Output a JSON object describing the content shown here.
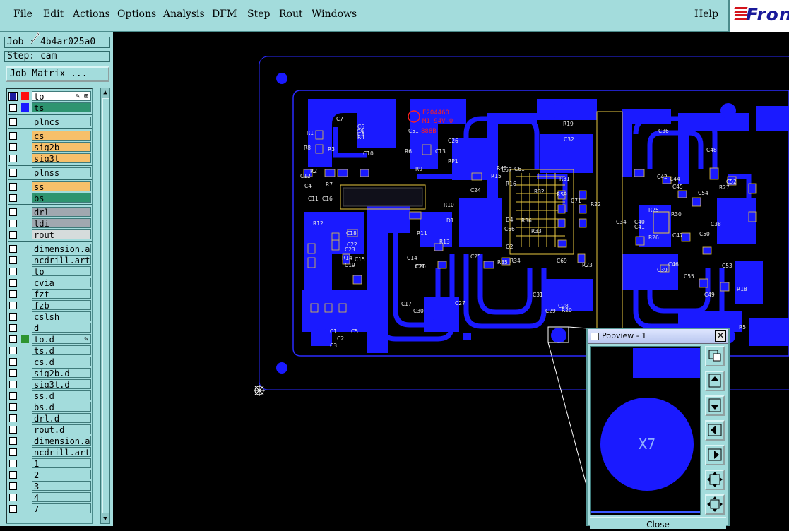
{
  "menu": {
    "items": [
      "File",
      "Edit",
      "Actions",
      "Options",
      "Analysis",
      "DFM",
      "Step",
      "Rout",
      "Windows"
    ],
    "help": "Help"
  },
  "logo": {
    "text": "Fron",
    "name": "frontline-logo"
  },
  "job": {
    "label": "Job : 4b4ar025a0",
    "step": "Step: cam"
  },
  "job_matrix_button": "Job Matrix ...",
  "layers": [
    {
      "name": "to",
      "color": "#ffffff",
      "swatch": "#ff1010",
      "checked": true,
      "flag": "✎ ⊞"
    },
    {
      "name": "ts",
      "color": "#2e9470",
      "swatch": "#1a1aff",
      "checked": false
    },
    {
      "name": "plncs",
      "color": "#a3dcdc",
      "checked": false
    },
    {
      "name": "cs",
      "color": "#f7c06a",
      "checked": false
    },
    {
      "name": "sig2b",
      "color": "#f7c06a",
      "checked": false
    },
    {
      "name": "sig3t",
      "color": "#f7c06a",
      "checked": false
    },
    {
      "name": "plnss",
      "color": "#a3dcdc",
      "checked": false
    },
    {
      "name": "ss",
      "color": "#f7c06a",
      "checked": false
    },
    {
      "name": "bs",
      "color": "#2e9470",
      "checked": false
    },
    {
      "name": "drl",
      "color": "#a0a8b0",
      "checked": false
    },
    {
      "name": "ldi",
      "color": "#a0a8b0",
      "checked": false
    },
    {
      "name": "rout",
      "color": "#d6dcdc",
      "checked": false
    },
    {
      "name": "dimension.ar",
      "color": "#a3dcdc",
      "checked": false
    },
    {
      "name": "ncdrill.art",
      "color": "#a3dcdc",
      "checked": false
    },
    {
      "name": "tp",
      "color": "#a3dcdc",
      "checked": false
    },
    {
      "name": "cvia",
      "color": "#a3dcdc",
      "checked": false
    },
    {
      "name": "fzt",
      "color": "#a3dcdc",
      "checked": false
    },
    {
      "name": "fzb",
      "color": "#a3dcdc",
      "checked": false
    },
    {
      "name": "cslsh",
      "color": "#a3dcdc",
      "checked": false
    },
    {
      "name": "d",
      "color": "#a3dcdc",
      "checked": false
    },
    {
      "name": "to.d",
      "color": "#a3dcdc",
      "swatch": "#2e9430",
      "checked": false,
      "flag": "✎"
    },
    {
      "name": "ts.d",
      "color": "#a3dcdc",
      "checked": false
    },
    {
      "name": "cs.d",
      "color": "#a3dcdc",
      "checked": false
    },
    {
      "name": "sig2b.d",
      "color": "#a3dcdc",
      "checked": false
    },
    {
      "name": "sig3t.d",
      "color": "#a3dcdc",
      "checked": false
    },
    {
      "name": "ss.d",
      "color": "#a3dcdc",
      "checked": false
    },
    {
      "name": "bs.d",
      "color": "#a3dcdc",
      "checked": false
    },
    {
      "name": "drl.d",
      "color": "#a3dcdc",
      "checked": false
    },
    {
      "name": "rout.d",
      "color": "#a3dcdc",
      "checked": false
    },
    {
      "name": "dimension.ar",
      "color": "#a3dcdc",
      "checked": false
    },
    {
      "name": "ncdrill.art",
      "color": "#a3dcdc",
      "checked": false
    },
    {
      "name": "1",
      "color": "#a3dcdc",
      "checked": false
    },
    {
      "name": "2",
      "color": "#a3dcdc",
      "checked": false
    },
    {
      "name": "3",
      "color": "#a3dcdc",
      "checked": false
    },
    {
      "name": "4",
      "color": "#a3dcdc",
      "checked": false
    },
    {
      "name": "7",
      "color": "#a3dcdc",
      "checked": false
    }
  ],
  "board": {
    "marking_lines": [
      "E204460",
      "M1 94V-0",
      "888B"
    ],
    "refdes": [
      {
        "t": "C51"
      },
      {
        "t": "C26"
      },
      {
        "t": "R19"
      },
      {
        "t": "C36"
      },
      {
        "t": "C48"
      },
      {
        "t": "C32"
      },
      {
        "t": "C24"
      },
      {
        "t": "R10"
      },
      {
        "t": "D1"
      },
      {
        "t": "R11"
      },
      {
        "t": "R13"
      },
      {
        "t": "C14"
      },
      {
        "t": "C21"
      },
      {
        "t": "C25"
      },
      {
        "t": "C17"
      },
      {
        "t": "C30"
      },
      {
        "t": "C27"
      },
      {
        "t": "C31"
      },
      {
        "t": "C29"
      },
      {
        "t": "R20"
      },
      {
        "t": "C28"
      },
      {
        "t": "C38"
      },
      {
        "t": "R25"
      },
      {
        "t": "R30"
      },
      {
        "t": "R26"
      },
      {
        "t": "C39"
      },
      {
        "t": "C47"
      },
      {
        "t": "C50"
      },
      {
        "t": "C53"
      },
      {
        "t": "C49"
      },
      {
        "t": "R18"
      },
      {
        "t": "R5"
      },
      {
        "t": "C42"
      },
      {
        "t": "C44"
      },
      {
        "t": "C54"
      },
      {
        "t": "R27"
      },
      {
        "t": "C52"
      },
      {
        "t": "C45"
      },
      {
        "t": "C46"
      },
      {
        "t": "C55"
      },
      {
        "t": "C40"
      },
      {
        "t": "C41"
      },
      {
        "t": "C34"
      },
      {
        "t": "R8"
      },
      {
        "t": "R1"
      },
      {
        "t": "R3"
      },
      {
        "t": "R6"
      },
      {
        "t": "C12"
      },
      {
        "t": "R7"
      },
      {
        "t": "C10"
      },
      {
        "t": "C11"
      },
      {
        "t": "C16"
      },
      {
        "t": "C18"
      },
      {
        "t": "C22"
      },
      {
        "t": "C23"
      },
      {
        "t": "R14"
      },
      {
        "t": "C19"
      },
      {
        "t": "C15"
      },
      {
        "t": "R12"
      },
      {
        "t": "C1"
      },
      {
        "t": "C2"
      },
      {
        "t": "C3"
      },
      {
        "t": "C5"
      },
      {
        "t": "C7"
      },
      {
        "t": "C9"
      },
      {
        "t": "C6"
      },
      {
        "t": "R4"
      },
      {
        "t": "R9"
      },
      {
        "t": "C13"
      },
      {
        "t": "RP1"
      },
      {
        "t": "R15"
      },
      {
        "t": "R16"
      },
      {
        "t": "R43"
      },
      {
        "t": "C57"
      },
      {
        "t": "C61"
      },
      {
        "t": "R31"
      },
      {
        "t": "R32"
      },
      {
        "t": "RS9"
      },
      {
        "t": "C71"
      },
      {
        "t": "R22"
      },
      {
        "t": "R36"
      },
      {
        "t": "R33"
      },
      {
        "t": "C69"
      },
      {
        "t": "R35"
      },
      {
        "t": "R34"
      },
      {
        "t": "R23"
      },
      {
        "t": "C66"
      },
      {
        "t": "D4"
      },
      {
        "t": "Q2"
      },
      {
        "t": "C8"
      },
      {
        "t": "R2"
      },
      {
        "t": "C20"
      },
      {
        "t": "C4"
      }
    ]
  },
  "popview": {
    "title": "Popview - 1",
    "close_glyph": "✕",
    "pad_label": "X7",
    "close_button": "Close",
    "buttons": [
      "zoom-window-icon",
      "pan-up-icon",
      "pan-down-icon",
      "pan-left-icon",
      "pan-right-icon",
      "fit-all-icon",
      "zoom-out-icon"
    ]
  },
  "colors": {
    "panel": "#a3dcdc",
    "copper": "#1a1aff",
    "silk": "#e8c840",
    "marking": "#ff2020",
    "outline": "#2a2aff"
  }
}
